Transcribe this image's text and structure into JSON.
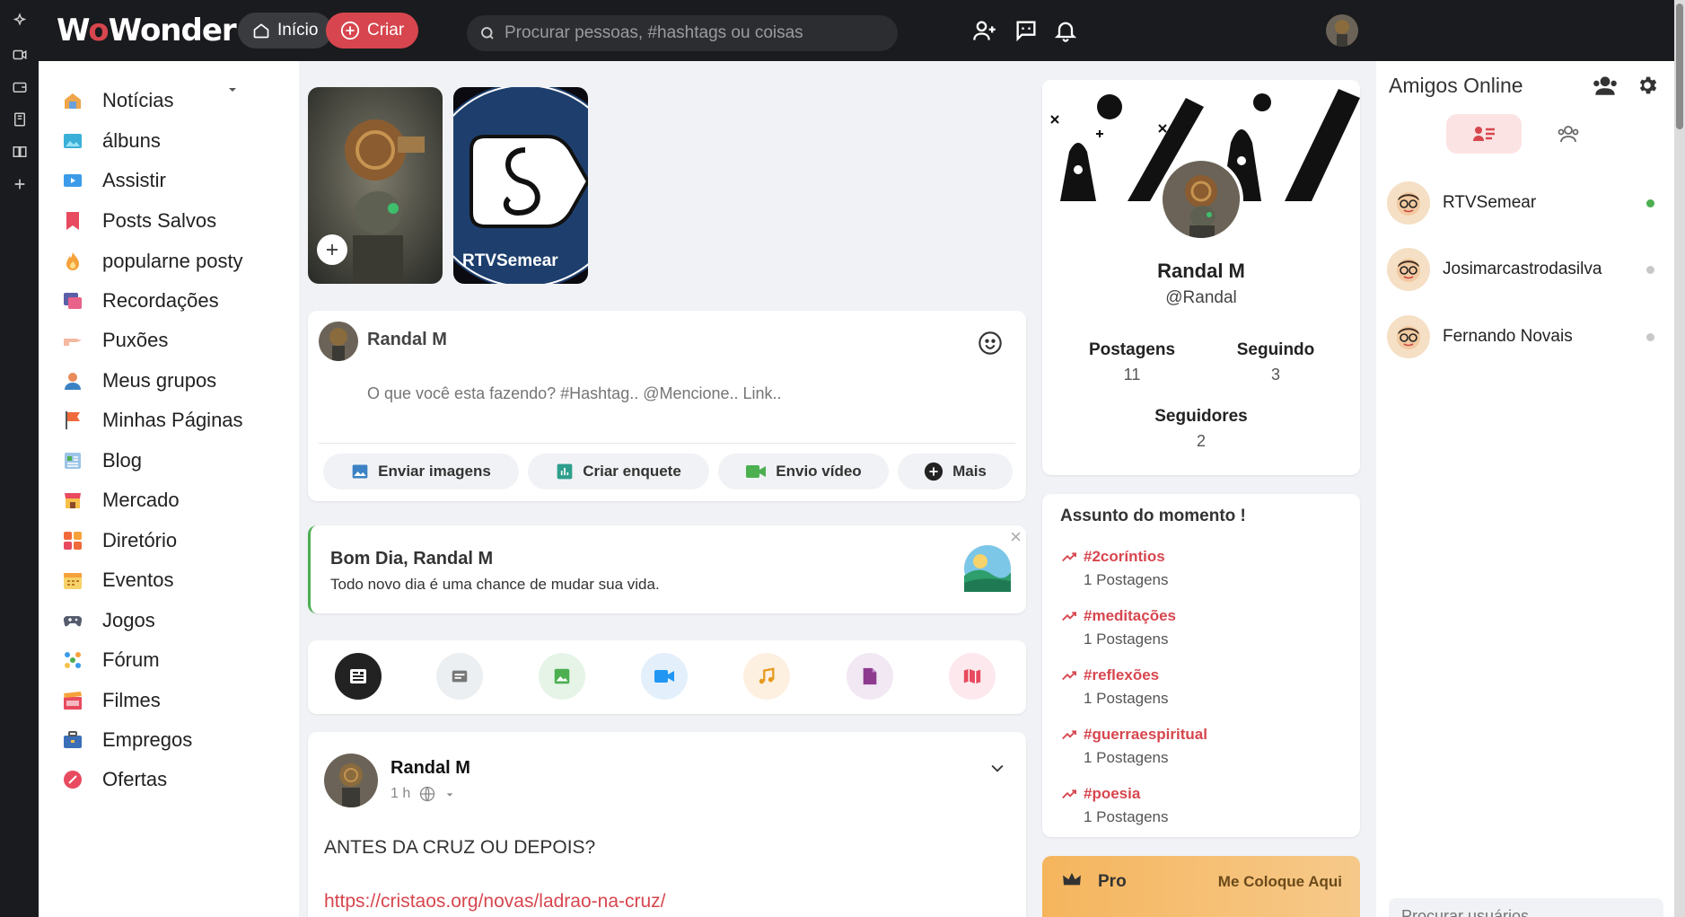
{
  "topbar": {
    "logo_prefix": "W",
    "logo_o": "o",
    "logo_suffix": "Wonder",
    "home_label": "Início",
    "create_label": "Criar",
    "search_placeholder": "Procurar pessoas, #hashtags ou coisas"
  },
  "colors": {
    "accent": "#d7464e",
    "dark": "#1a1b1e",
    "online": "#4caf50"
  },
  "sidebar": {
    "items": [
      {
        "label": "Notícias",
        "icon": "news-icon"
      },
      {
        "label": "álbuns",
        "icon": "albums-icon"
      },
      {
        "label": "Assistir",
        "icon": "watch-icon"
      },
      {
        "label": "Posts Salvos",
        "icon": "bookmark-icon"
      },
      {
        "label": "popularne posty",
        "icon": "fire-icon"
      },
      {
        "label": "Recordações",
        "icon": "memories-icon"
      },
      {
        "label": "Puxões",
        "icon": "poke-icon"
      },
      {
        "label": "Meus grupos",
        "icon": "groups-icon"
      },
      {
        "label": "Minhas Páginas",
        "icon": "flag-icon"
      },
      {
        "label": "Blog",
        "icon": "blog-icon"
      },
      {
        "label": "Mercado",
        "icon": "market-icon"
      },
      {
        "label": "Diretório",
        "icon": "directory-icon"
      },
      {
        "label": "Eventos",
        "icon": "calendar-icon"
      },
      {
        "label": "Jogos",
        "icon": "gamepad-icon"
      },
      {
        "label": "Fórum",
        "icon": "forum-icon"
      },
      {
        "label": "Filmes",
        "icon": "movies-icon"
      },
      {
        "label": "Empregos",
        "icon": "briefcase-icon"
      },
      {
        "label": "Ofertas",
        "icon": "offers-icon"
      }
    ]
  },
  "stories": [
    {
      "name": ""
    },
    {
      "name": "RTVSemear"
    }
  ],
  "composer": {
    "user": "Randal M",
    "placeholder": "O que você esta fazendo? #Hashtag.. @Mencione.. Link..",
    "buttons": [
      "Enviar imagens",
      "Criar enquete",
      "Envio vídeo",
      "Mais"
    ]
  },
  "greeting": {
    "title": "Bom Dia, Randal M",
    "text": "Todo novo dia é uma chance de mudar sua vida.",
    "close": "×"
  },
  "post": {
    "author": "Randal M",
    "time": "1 h",
    "text": "ANTES DA CRUZ OU DEPOIS?",
    "link": "https://cristaos.org/novas/ladrao-na-cruz/"
  },
  "profile": {
    "name": "Randal M",
    "handle": "@Randal",
    "stats": [
      {
        "label": "Postagens",
        "value": "11"
      },
      {
        "label": "Seguindo",
        "value": "3"
      },
      {
        "label": "Seguidores",
        "value": "2"
      }
    ]
  },
  "trending": {
    "title": "Assunto do momento !",
    "items": [
      {
        "tag": "#2coríntios",
        "count": "1 Postagens"
      },
      {
        "tag": "#meditações",
        "count": "1 Postagens"
      },
      {
        "tag": "#reflexões",
        "count": "1 Postagens"
      },
      {
        "tag": "#guerraespiritual",
        "count": "1 Postagens"
      },
      {
        "tag": "#poesia",
        "count": "1 Postagens"
      }
    ]
  },
  "pro": {
    "label": "Pro",
    "cta": "Me Coloque Aqui"
  },
  "friends": {
    "title": "Amigos Online",
    "list": [
      {
        "name": "RTVSemear",
        "online": true
      },
      {
        "name": "Josimarcastrodasilva",
        "online": false
      },
      {
        "name": "Fernando Novais",
        "online": false
      }
    ],
    "search_placeholder": "Procurar usuários"
  }
}
